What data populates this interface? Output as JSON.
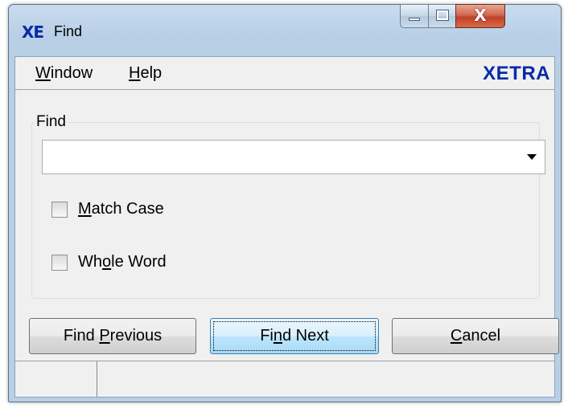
{
  "window": {
    "app_logo": "XE",
    "title": "Find",
    "buttons": {
      "minimize": "minimize",
      "maximize": "maximize",
      "close": "close"
    }
  },
  "menubar": {
    "items": [
      {
        "label": "Window",
        "mnemonic": "W",
        "rest": "indow"
      },
      {
        "label": "Help",
        "mnemonic": "H",
        "rest": "elp"
      }
    ],
    "brand": "XETRA"
  },
  "find_group": {
    "label": "Find",
    "search": {
      "value": "",
      "placeholder": ""
    }
  },
  "options": {
    "match_case": {
      "pre": "",
      "mnemonic": "M",
      "post": "atch Case",
      "checked": false
    },
    "whole_word": {
      "pre": "Wh",
      "mnemonic": "o",
      "post": "le Word",
      "checked": false
    }
  },
  "buttons": {
    "find_previous": {
      "pre": "Find ",
      "mnemonic": "P",
      "post": "revious"
    },
    "find_next": {
      "pre": "Fi",
      "mnemonic": "n",
      "post": "d Next"
    },
    "cancel": {
      "pre": "",
      "mnemonic": "C",
      "post": "ancel"
    }
  },
  "statusbar": {
    "cell1": "",
    "cell2": ""
  },
  "icons": {
    "dropdown": "triangle-down",
    "close": "x-mark",
    "minimize": "underscore-bar",
    "maximize": "square-outline"
  },
  "colors": {
    "accent": "#0a2aa8",
    "client_bg": "#f0f0f0",
    "title_bar": "#b8cfe6",
    "close_button": "#c0412a",
    "default_button": "#bee6fd"
  }
}
